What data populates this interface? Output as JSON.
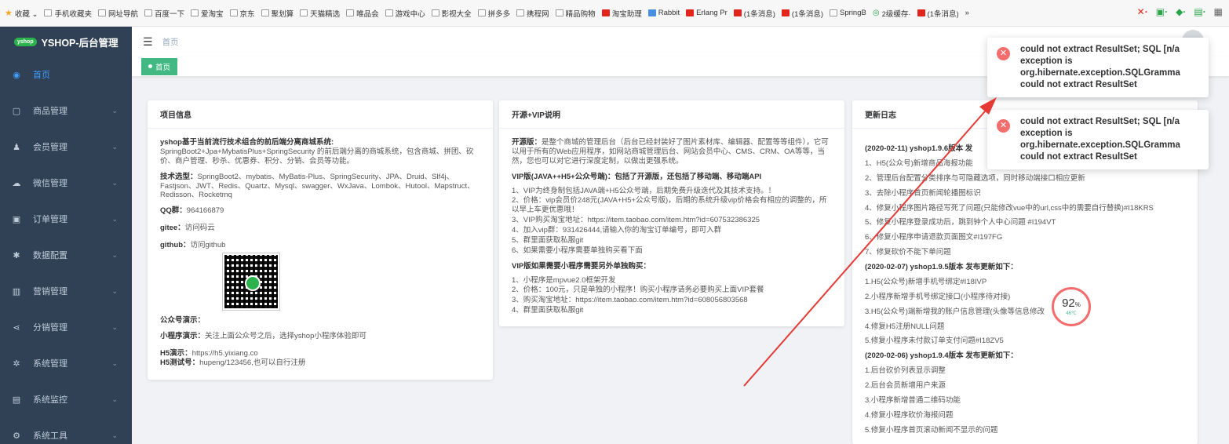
{
  "bookmarks": [
    {
      "label": "收藏 ⌄",
      "icon": "star-icon"
    },
    {
      "label": "手机收藏夹",
      "icon": "page-icon"
    },
    {
      "label": "网址导航",
      "icon": "page-icon"
    },
    {
      "label": "百度一下",
      "icon": "page-icon"
    },
    {
      "label": "爱淘宝",
      "icon": "page-icon"
    },
    {
      "label": "京东",
      "icon": "page-icon"
    },
    {
      "label": "聚划算",
      "icon": "page-icon"
    },
    {
      "label": "天猫精选",
      "icon": "page-icon"
    },
    {
      "label": "唯品会",
      "icon": "page-icon"
    },
    {
      "label": "游戏中心",
      "icon": "page-icon"
    },
    {
      "label": "影视大全",
      "icon": "page-icon"
    },
    {
      "label": "拼多多",
      "icon": "page-icon"
    },
    {
      "label": "携程网",
      "icon": "page-icon"
    },
    {
      "label": "精品购物",
      "icon": "page-icon"
    },
    {
      "label": "淘宝助理",
      "icon": "red-page-icon"
    },
    {
      "label": "Rabbit",
      "icon": "blue-page-icon"
    },
    {
      "label": "Erlang Pr",
      "icon": "red-page-icon"
    },
    {
      "label": "(1条消息)",
      "icon": "red-page-icon"
    },
    {
      "label": "(1条消息)",
      "icon": "red-page-icon"
    },
    {
      "label": "SpringB",
      "icon": "page-icon"
    },
    {
      "label": "2级缓存·",
      "icon": "green-page-icon"
    },
    {
      "label": "(1条消息)",
      "icon": "red-page-icon"
    },
    {
      "label": "»",
      "icon": "none"
    }
  ],
  "sidebar": {
    "logo_badge": "yshop",
    "logo_text": "YSHOP-后台管理",
    "items": [
      {
        "label": "首页",
        "icon": "dashboard-icon",
        "active": true
      },
      {
        "label": "商品管理",
        "icon": "goods-icon"
      },
      {
        "label": "会员管理",
        "icon": "member-icon"
      },
      {
        "label": "微信管理",
        "icon": "wechat-icon"
      },
      {
        "label": "订单管理",
        "icon": "order-icon"
      },
      {
        "label": "数据配置",
        "icon": "config-icon"
      },
      {
        "label": "营销管理",
        "icon": "marketing-icon"
      },
      {
        "label": "分销管理",
        "icon": "share-icon"
      },
      {
        "label": "系统管理",
        "icon": "system-icon"
      },
      {
        "label": "系统监控",
        "icon": "monitor-icon"
      },
      {
        "label": "系统工具",
        "icon": "tools-icon"
      }
    ]
  },
  "header": {
    "breadcrumb": "首页"
  },
  "tags": [
    {
      "label": "首页"
    }
  ],
  "project": {
    "title": "项目信息",
    "intro_title": "yshop基于当前流行技术组合的前后端分离商城系统:",
    "intro_body": "SpringBoot2+Jpa+MybatisPlus+SpringSecurity 的前后端分离的商城系统，包含商城、拼团、砍价、商户管理、秒杀、优惠券、积分、分销、会员等功能。",
    "tech_label": "技术选型：",
    "tech_body": "SpringBoot2、mybatis、MyBatis-Plus、SpringSecurity、JPA、Druid、Slf4j、Fastjson、JWT、Redis、Quartz、Mysql、swagger、WxJava、Lombok、Hutool、Mapstruct、Redisson、Rocketmq",
    "qq_label": "QQ群：",
    "qq_value": "964166879",
    "gitee_label": "gitee：",
    "gitee_value": "访问码云",
    "github_label": "github：",
    "github_value": "访问github",
    "gzh_label": "公众号演示：",
    "mini_label": "小程序演示：",
    "mini_value": "关注上面公众号之后，选择yshop小程序体验即可",
    "h5_label": "H5演示：",
    "h5_value": "https://h5.yixiang.co",
    "h5_acct_label": "H5测试号：",
    "h5_acct_value": "hupeng/123456,也可以自行注册"
  },
  "vip": {
    "title": "开源+VIP说明",
    "open_label": "开源版：",
    "open_body": "是整个商城的管理后台（后台已经封装好了图片素材库、编辑器、配置等等组件），它可以用于所有的Web应用程序，如网站商城管理后台、网站会员中心、CMS、CRM、OA等等，当然，您也可以对它进行深度定制，以做出更强系统。",
    "vip_title": "VIP版(JAVA++H5+公众号端)：包括了开源版，还包括了移动端、移动端API",
    "items": [
      "1、VIP为终身制包括JAVA端+H5公众号端，后期免费升级迭代及其技术支持。！",
      "2、价格：vip会员价248元(JAVA+H5+公众号版)，后期的系统升级vip价格会有相应的调整的，所以早上车更优惠哦！",
      "3、VIP购买淘宝地址：https://item.taobao.com/item.htm?id=607532386325",
      "4、加入vip群：931426444,请输入你的淘宝订单编号，即可入群",
      "5、群里面获取私服git",
      "6、如果需要小程序需要单独购买看下面"
    ],
    "mini_title": "VIP版如果需要小程序需要另外单独购买：",
    "mini_items": [
      "1、小程序是mpvue2.0框架开发",
      "2、价格：100元，只是单独的小程序！购买小程序请务必要购买上面VIP套餐",
      "3、购买淘宝地址：https://item.taobao.com/item.htm?id=608056803568",
      "4、群里面获取私服git"
    ]
  },
  "changelog": {
    "title": "更新日志",
    "lines": [
      {
        "text": "(2020-02-11) yshop1.9.6版本 发",
        "head": true
      },
      {
        "text": "1、H5(公众号)新增商品海报功能",
        "head": false
      },
      {
        "text": "2、管理后台配置分类排序与可隐藏选项，同时移动端接口相应更新",
        "head": false
      },
      {
        "text": "3、去除小程序首页新闻轮播图标识",
        "head": false
      },
      {
        "text": "4、修复小程序图片路径写死了问题(只能修改vue中的url,css中的需要自行替换)#I18KRS",
        "head": false
      },
      {
        "text": "5、修复小程序登录成功后，跳到钟个人中心问题 #I194VT",
        "head": false
      },
      {
        "text": "6、修复小程序申请退款页面图文#I197FG",
        "head": false
      },
      {
        "text": "7、修复砍价不能下单问题",
        "head": false
      },
      {
        "text": "(2020-02-07) yshop1.9.5版本 发布更新如下：",
        "head": true
      },
      {
        "text": "1.H5(公众号)新增手机号绑定#I18IVP",
        "head": false
      },
      {
        "text": "2.小程序新增手机号绑定接口(小程序待对接)",
        "head": false
      },
      {
        "text": "3.H5(公众号)端新增我的账户信息管理(头像等信息修改",
        "head": false
      },
      {
        "text": "4.修复H5注册NULL问题",
        "head": false
      },
      {
        "text": "5.修复小程序未付款订单支付问题#I18ZV5",
        "head": false
      },
      {
        "text": "(2020-02-06) yshop1.9.4版本 发布更新如下：",
        "head": true
      },
      {
        "text": "1.后台砍价列表显示调整",
        "head": false
      },
      {
        "text": "2.后台会员新增用户来源",
        "head": false
      },
      {
        "text": "3.小程序新增普通二维码功能",
        "head": false
      },
      {
        "text": "4.修复小程序砍价海报问题",
        "head": false
      },
      {
        "text": "5.修复小程序首页滚动新闻不显示的问题",
        "head": false
      }
    ]
  },
  "gauge": {
    "value": "92",
    "unit": "%",
    "temp": "46℃"
  },
  "notifications": [
    {
      "lines": [
        "could not extract ResultSet; SQL [n/a",
        "exception is",
        "org.hibernate.exception.SQLGramma",
        "could not extract ResultSet"
      ]
    },
    {
      "lines": [
        "could not extract ResultSet; SQL [n/a",
        "exception is",
        "org.hibernate.exception.SQLGramma",
        "could not extract ResultSet"
      ]
    }
  ],
  "colors": {
    "sidebar_bg": "#304156",
    "active": "#409eff",
    "tag": "#42b983",
    "error": "#f56c6c",
    "arrow": "#e53935"
  }
}
